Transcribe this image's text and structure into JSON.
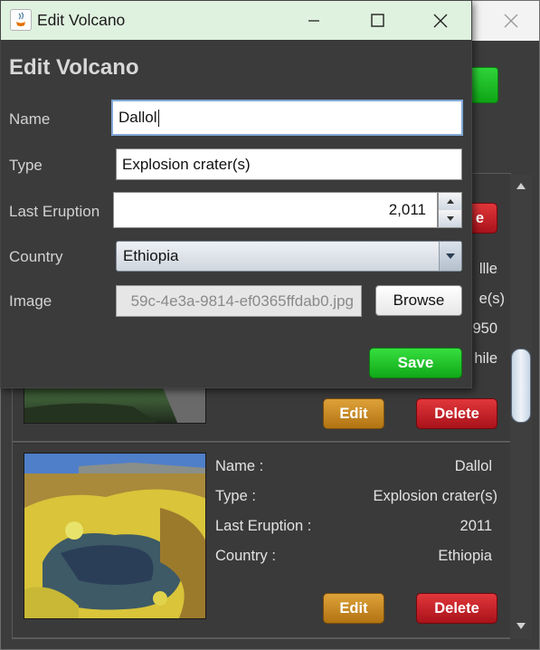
{
  "dialog": {
    "window_title": "Edit Volcano",
    "heading": "Edit Volcano",
    "fields": {
      "name_label": "Name",
      "name_value": "Dallol",
      "type_label": "Type",
      "type_value": "Explosion crater(s)",
      "last_eruption_label": "Last Eruption",
      "last_eruption_value": "2,011",
      "country_label": "Country",
      "country_value": "Ethiopia",
      "image_label": "Image",
      "image_value": "59c-4e3a-9814-ef0365ffdab0.jpg"
    },
    "browse_label": "Browse",
    "save_label": "Save",
    "icons": {
      "app": "java-icon",
      "minimize": "minimize-icon",
      "maximize": "maximize-icon",
      "close": "close-icon"
    }
  },
  "main_window": {
    "partial_texts": {
      "delete_fragment": "e",
      "name_fragment": "llle",
      "type_fragment": "e(s)",
      "eruption_fragment": "950",
      "country_fragment": "hile"
    },
    "cards": [
      {
        "edit_label": "Edit",
        "delete_label": "Delete"
      },
      {
        "name_label": "Name :",
        "name": "Dallol",
        "type_label": "Type :",
        "type": "Explosion crater(s)",
        "last_eruption_label": "Last Eruption :",
        "last_eruption": "2011",
        "country_label": "Country :",
        "country": "Ethiopia",
        "edit_label": "Edit",
        "delete_label": "Delete"
      }
    ]
  },
  "colors": {
    "save": "#1cb624",
    "edit": "#c98a22",
    "delete": "#c0181f",
    "background": "#3b3b3b"
  }
}
